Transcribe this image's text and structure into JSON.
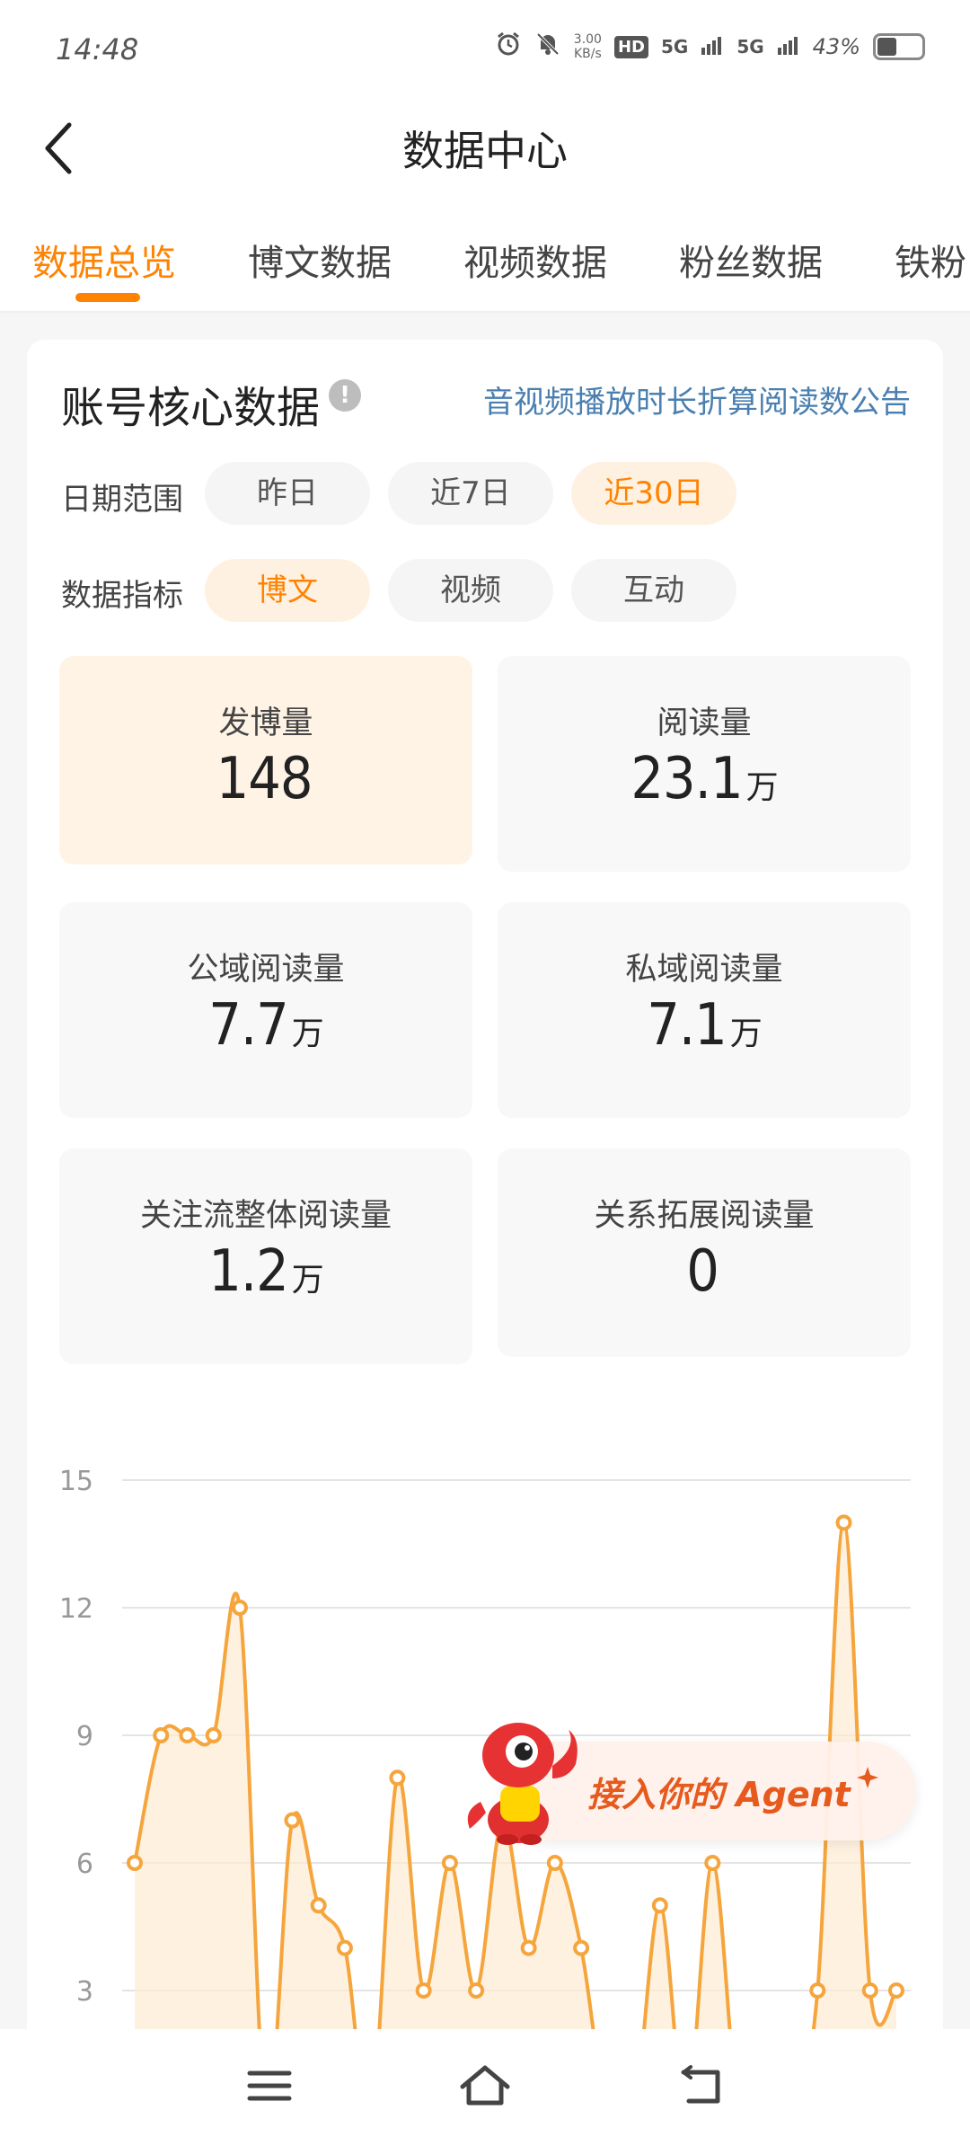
{
  "status_bar": {
    "time": "14:48",
    "net_speed_value": "3.00",
    "net_speed_unit": "KB/s",
    "hd_label": "HD",
    "signal1": "5G",
    "signal2": "5G",
    "battery_text": "43%",
    "battery_level": 0.43
  },
  "header": {
    "title": "数据中心"
  },
  "tabs": [
    {
      "label": "数据总览",
      "active": true
    },
    {
      "label": "博文数据",
      "active": false
    },
    {
      "label": "视频数据",
      "active": false
    },
    {
      "label": "粉丝数据",
      "active": false
    },
    {
      "label": "铁粉",
      "active": false
    }
  ],
  "card": {
    "title": "账号核心数据",
    "info_glyph": "!",
    "notice_link": "音视频播放时长折算阅读数公告",
    "date_range": {
      "label": "日期范围",
      "options": [
        "昨日",
        "近7日",
        "近30日"
      ],
      "selected": "近30日"
    },
    "metric_type": {
      "label": "数据指标",
      "options": [
        "博文",
        "视频",
        "互动"
      ],
      "selected": "博文"
    },
    "metrics": [
      {
        "label": "发博量",
        "value": "148",
        "unit": ""
      },
      {
        "label": "阅读量",
        "value": "23.1",
        "unit": "万"
      },
      {
        "label": "公域阅读量",
        "value": "7.7",
        "unit": "万"
      },
      {
        "label": "私域阅读量",
        "value": "7.1",
        "unit": "万"
      },
      {
        "label": "关注流整体阅读量",
        "value": "1.2",
        "unit": "万"
      },
      {
        "label": "关系拓展阅读量",
        "value": "0",
        "unit": ""
      }
    ]
  },
  "chart_data": {
    "type": "area",
    "y_ticks": [
      "15",
      "12",
      "9",
      "6",
      "3"
    ],
    "ylim": [
      0,
      15
    ],
    "grid": true,
    "x": [
      1,
      2,
      3,
      4,
      5,
      6,
      7,
      8,
      9,
      10,
      11,
      12,
      13,
      14,
      15,
      16,
      17,
      18,
      19,
      20,
      21,
      22,
      23,
      24,
      25,
      26,
      27,
      28,
      29,
      30
    ],
    "series": [
      {
        "values": [
          6,
          9,
          9,
          9,
          12,
          0,
          7,
          5,
          4,
          0,
          8,
          3,
          6,
          3,
          7,
          4,
          6,
          4,
          0,
          0,
          5,
          0,
          6,
          0,
          0,
          0,
          3,
          14,
          3,
          3
        ],
        "color": "#f5a53c"
      }
    ]
  },
  "agent_badge": {
    "text": "接入你的 Agent"
  },
  "colors": {
    "accent": "#ff8200",
    "link": "#4a7fb0",
    "chart_line": "#f5a53c"
  },
  "icons": {
    "back": "chevron-left-icon",
    "menu": "menu-icon",
    "home": "home-icon",
    "return": "back-arrow-icon"
  }
}
